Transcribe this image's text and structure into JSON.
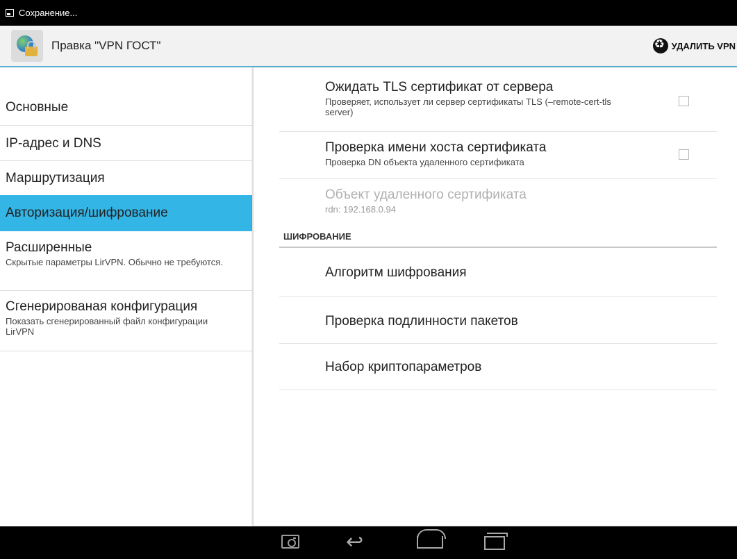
{
  "status_bar": {
    "text": "Сохранение...",
    "icon": "image-icon"
  },
  "action_bar": {
    "title": "Правка \"VPN ГОСТ\"",
    "delete_label": "УДАЛИТЬ VPN",
    "delete_icon": "recycle-icon"
  },
  "sidebar": {
    "items": [
      {
        "label": "Основные",
        "sub": ""
      },
      {
        "label": "IP-адрес и DNS",
        "sub": ""
      },
      {
        "label": "Маршрутизация",
        "sub": ""
      },
      {
        "label": "Авторизация/шифрование",
        "sub": "",
        "selected": true
      },
      {
        "label": "Расширенные",
        "sub": "Скрытые параметры LirVPN. Обычно не требуются."
      },
      {
        "label": "Сгенерированая конфигурация",
        "sub": "Показать сгенерированный файл конфигурации LirVPN"
      }
    ]
  },
  "prefs": {
    "tls": {
      "title": "Ожидать TLS сертификат от сервера",
      "summary": "Проверяет, использует ли сервер сертификаты TLS (–remote-cert-tls server)",
      "checked": false
    },
    "hostname": {
      "title": "Проверка имени хоста сертификата",
      "summary": "Проверка DN объекта удаленного сертификата",
      "checked": false
    },
    "remote_obj": {
      "title": "Объект удаленного сертификата",
      "summary": "rdn: 192.168.0.94",
      "enabled": false
    }
  },
  "encryption_section": {
    "header": "ШИФРОВАНИЕ",
    "items": [
      {
        "title": "Алгоритм шифрования"
      },
      {
        "title": "Проверка подлинности пакетов"
      },
      {
        "title": "Набор криптопараметров"
      }
    ]
  },
  "colors": {
    "accent": "#33b5e5",
    "actionbar_line": "#5aaecf",
    "bar_bg": "#000000"
  },
  "nav_bar": {
    "icons": [
      "screenshot-icon",
      "back-icon",
      "home-icon",
      "recents-icon"
    ]
  }
}
